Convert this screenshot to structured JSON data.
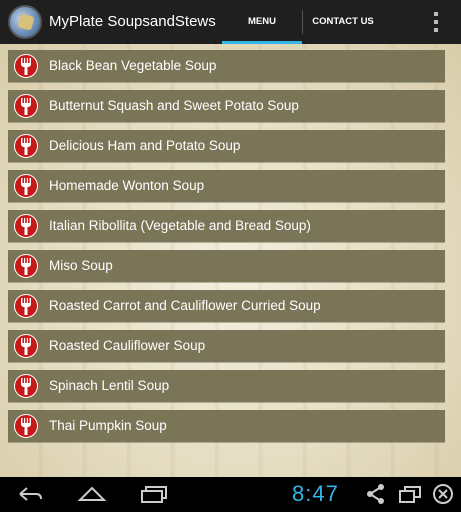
{
  "app": {
    "title": "MyPlate SoupsandStews"
  },
  "tabs": [
    {
      "label": "MENU",
      "selected": true
    },
    {
      "label": "CONTACT US",
      "selected": false
    }
  ],
  "icons": {
    "app_icon": "app-logo-icon",
    "overflow": "overflow-menu-icon",
    "row_badge": "fork-icon"
  },
  "colors": {
    "accent": "#33b5e5",
    "badge": "#c61a1a",
    "row": "#7b7558"
  },
  "items": [
    {
      "label": "Black Bean Vegetable Soup"
    },
    {
      "label": "Butternut Squash and Sweet Potato Soup"
    },
    {
      "label": "Delicious Ham and Potato Soup"
    },
    {
      "label": "Homemade Wonton Soup"
    },
    {
      "label": "Italian Ribollita (Vegetable and Bread Soup)"
    },
    {
      "label": "Miso Soup"
    },
    {
      "label": "Roasted Carrot and Cauliflower Curried Soup"
    },
    {
      "label": "Roasted Cauliflower Soup"
    },
    {
      "label": "Spinach Lentil Soup"
    },
    {
      "label": "Thai Pumpkin Soup"
    }
  ],
  "status": {
    "time": "8:47"
  },
  "navbar": {
    "icons": [
      "back-icon",
      "home-icon",
      "recents-icon",
      "share-icon",
      "window-icon",
      "close-icon"
    ]
  }
}
